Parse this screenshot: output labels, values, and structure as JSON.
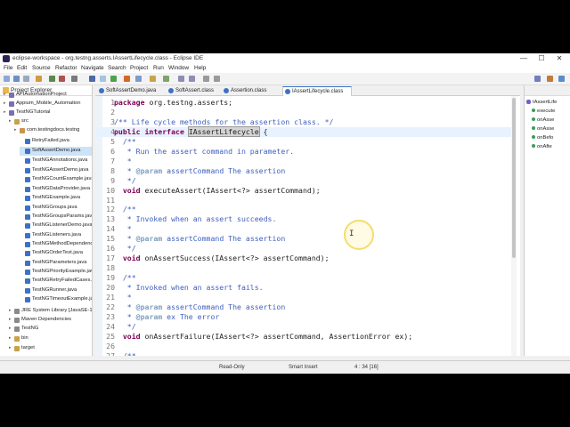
{
  "window": {
    "title": "eclipse-workspace - org.testng.asserts.IAssertLifecycle.class - Eclipse IDE",
    "controls": [
      "—",
      "☐",
      "✕"
    ]
  },
  "menu": [
    "File",
    "Edit",
    "Source",
    "Refactor",
    "Navigate",
    "Search",
    "Project",
    "Run",
    "Window",
    "Help"
  ],
  "explorer": {
    "title": "Project Explorer",
    "items": [
      {
        "label": "APIAutomationProject",
        "color": "#7a6fb0"
      },
      {
        "label": "Appium_Mobile_Automation",
        "color": "#7a6fb0"
      },
      {
        "label": "TestNGTutorial",
        "color": "#7a6fb0"
      },
      {
        "label": "src",
        "color": "#c7a24a"
      },
      {
        "label": "com.testingdocs.testng",
        "color": "#c9944a"
      },
      {
        "label": "RetryFailed.java",
        "color": "#3b72c4"
      },
      {
        "label": "SoftAssertDemo.java",
        "color": "#3b72c4"
      },
      {
        "label": "TestNGAnnotations.java",
        "color": "#3b72c4"
      },
      {
        "label": "TestNGAssertDemo.java",
        "color": "#3b72c4"
      },
      {
        "label": "TestNGCountExample.java",
        "color": "#3b72c4"
      },
      {
        "label": "TestNGDataProvider.java",
        "color": "#3b72c4"
      },
      {
        "label": "TestNGExample.java",
        "color": "#3b72c4"
      },
      {
        "label": "TestNGGroups.java",
        "color": "#3b72c4"
      },
      {
        "label": "TestNGGroupsParams.java",
        "color": "#3b72c4"
      },
      {
        "label": "TestNGListenerDemo.java",
        "color": "#3b72c4"
      },
      {
        "label": "TestNGListeners.java",
        "color": "#3b72c4"
      },
      {
        "label": "TestNGMethodDependency.java",
        "color": "#3b72c4"
      },
      {
        "label": "TestNGOrderTest.java",
        "color": "#3b72c4"
      },
      {
        "label": "TestNGParameters.java",
        "color": "#3b72c4"
      },
      {
        "label": "TestNGPriorityExample.java",
        "color": "#3b72c4"
      },
      {
        "label": "TestNGRetryFailedCases.java",
        "color": "#3b72c4"
      },
      {
        "label": "TestNGRunner.java",
        "color": "#3b72c4"
      },
      {
        "label": "TestNGTimeoutExample.java",
        "color": "#3b72c4"
      },
      {
        "label": "JRE System Library [JavaSE-17]",
        "color": "#8a8a8a"
      },
      {
        "label": "Maven Dependencies",
        "color": "#8a8a8a"
      },
      {
        "label": "TestNG",
        "color": "#8a8a8a"
      },
      {
        "label": "bin",
        "color": "#c7a24a"
      },
      {
        "label": "target",
        "color": "#c7a24a"
      }
    ]
  },
  "editor": {
    "tabs": [
      "SoftAssertDemo.java",
      "SoftAssert.class",
      "Assertion.class",
      "IAssertLifecycle.class"
    ],
    "lines": [
      {
        "n": "1",
        "seg": [
          [
            "kw",
            "package"
          ],
          [
            "",
            " org.testng.asserts;"
          ]
        ]
      },
      {
        "n": "2",
        "seg": [
          [
            "",
            ""
          ]
        ]
      },
      {
        "n": "3",
        "seg": [
          [
            "jd",
            "/** Life cycle methods for the assertion class. */"
          ]
        ]
      },
      {
        "n": "4",
        "seg": [
          [
            "kw",
            "public interface"
          ],
          [
            "",
            " "
          ],
          [
            "hl",
            "IAssertLifecycle"
          ],
          [
            "",
            " {"
          ]
        ]
      },
      {
        "n": "5",
        "seg": [
          [
            "jd",
            "  /**"
          ]
        ]
      },
      {
        "n": "6",
        "seg": [
          [
            "jd",
            "   * Run the assert command in parameter."
          ]
        ]
      },
      {
        "n": "7",
        "seg": [
          [
            "jd",
            "   *"
          ]
        ]
      },
      {
        "n": "8",
        "seg": [
          [
            "jd",
            "   * "
          ],
          [
            "jt",
            "@param"
          ],
          [
            "jd",
            " assertCommand The assertion"
          ]
        ]
      },
      {
        "n": "9",
        "seg": [
          [
            "jd",
            "   */"
          ]
        ]
      },
      {
        "n": "10",
        "seg": [
          [
            "kw",
            "  void"
          ],
          [
            "",
            " executeAssert(IAssert<?> assertCommand);"
          ]
        ]
      },
      {
        "n": "11",
        "seg": [
          [
            "",
            ""
          ]
        ]
      },
      {
        "n": "12",
        "seg": [
          [
            "jd",
            "  /**"
          ]
        ]
      },
      {
        "n": "13",
        "seg": [
          [
            "jd",
            "   * Invoked when an assert succeeds."
          ]
        ]
      },
      {
        "n": "14",
        "seg": [
          [
            "jd",
            "   *"
          ]
        ]
      },
      {
        "n": "15",
        "seg": [
          [
            "jd",
            "   * "
          ],
          [
            "jt",
            "@param"
          ],
          [
            "jd",
            " assertCommand The assertion"
          ]
        ]
      },
      {
        "n": "16",
        "seg": [
          [
            "jd",
            "   */"
          ]
        ]
      },
      {
        "n": "17",
        "seg": [
          [
            "kw",
            "  void"
          ],
          [
            "",
            " onAssertSuccess(IAssert<?> assertCommand);"
          ]
        ]
      },
      {
        "n": "18",
        "seg": [
          [
            "",
            ""
          ]
        ]
      },
      {
        "n": "19",
        "seg": [
          [
            "jd",
            "  /**"
          ]
        ]
      },
      {
        "n": "20",
        "seg": [
          [
            "jd",
            "   * Invoked when an assert fails."
          ]
        ]
      },
      {
        "n": "21",
        "seg": [
          [
            "jd",
            "   *"
          ]
        ]
      },
      {
        "n": "22",
        "seg": [
          [
            "jd",
            "   * "
          ],
          [
            "jt",
            "@param"
          ],
          [
            "jd",
            " assertCommand The assertion"
          ]
        ]
      },
      {
        "n": "23",
        "seg": [
          [
            "jd",
            "   * "
          ],
          [
            "jt",
            "@param"
          ],
          [
            "jd",
            " ex The error"
          ]
        ]
      },
      {
        "n": "24",
        "seg": [
          [
            "jd",
            "   */"
          ]
        ]
      },
      {
        "n": "25",
        "seg": [
          [
            "kw",
            "  void"
          ],
          [
            "",
            " onAssertFailure(IAssert<?> assertCommand, AssertionError ex);"
          ]
        ]
      },
      {
        "n": "26",
        "seg": [
          [
            "",
            ""
          ]
        ]
      },
      {
        "n": "27",
        "seg": [
          [
            "jd",
            "  /**"
          ]
        ]
      }
    ]
  },
  "outline": {
    "items": [
      "IAssertLife",
      "execute",
      "onAsse",
      "onAsse",
      "onBefo",
      "onAfte"
    ]
  },
  "status": {
    "mode": "Read-Only",
    "insert": "Smart Insert",
    "position": "4 : 34 [16]"
  }
}
